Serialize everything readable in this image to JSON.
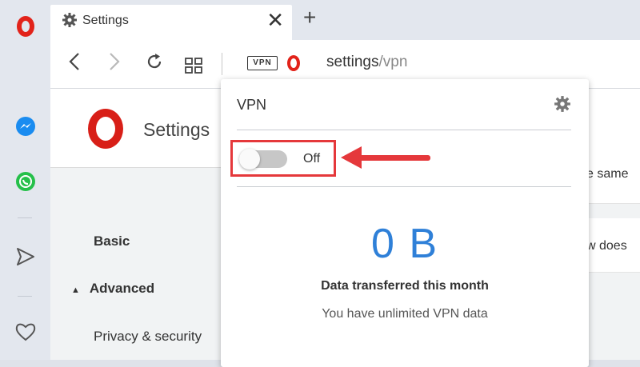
{
  "tab": {
    "title": "Settings",
    "close_symbol": "✕",
    "new_tab_symbol": "+"
  },
  "toolbar": {
    "vpn_badge": "VPN",
    "url_host": "settings",
    "url_path": "/vpn",
    "back_symbol": "‹",
    "forward_symbol": "›",
    "reload_symbol": "↻"
  },
  "page": {
    "title": "Settings",
    "nav": [
      "Basic",
      "Advanced",
      "Privacy & security"
    ],
    "advanced_marker": "▲",
    "bg_fragments": [
      "e same",
      "w does"
    ]
  },
  "vpn_popup": {
    "title": "VPN",
    "toggle_state": "Off",
    "data_value": "0 B",
    "data_label": "Data transferred this month",
    "data_sub": "You have unlimited VPN data"
  },
  "colors": {
    "opera_red": "#e2231a",
    "accent_blue": "#2f80d8",
    "highlight_red": "#e5383b",
    "messenger_blue": "#1a8cf0",
    "whatsapp_green": "#25c04a"
  },
  "icons": [
    "opera-logo-icon",
    "messenger-icon",
    "whatsapp-icon",
    "send-icon",
    "heart-icon",
    "gear-icon",
    "grid-icon"
  ]
}
